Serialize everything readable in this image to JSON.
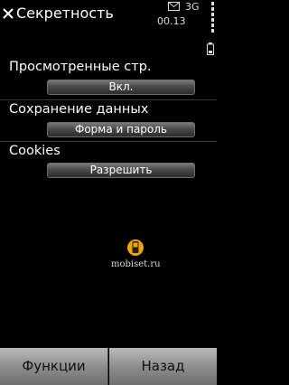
{
  "title": "Секретность",
  "status": {
    "time": "00.13",
    "network": "3G"
  },
  "settings": [
    {
      "label": "Просмотренные стр.",
      "value": "Вкл."
    },
    {
      "label": "Сохранение данных",
      "value": "Форма и пароль"
    },
    {
      "label": "Cookies",
      "value": "Разрешить"
    }
  ],
  "watermark": "mobiset.ru",
  "softkeys": {
    "left": "Функции",
    "right": "Назад"
  }
}
